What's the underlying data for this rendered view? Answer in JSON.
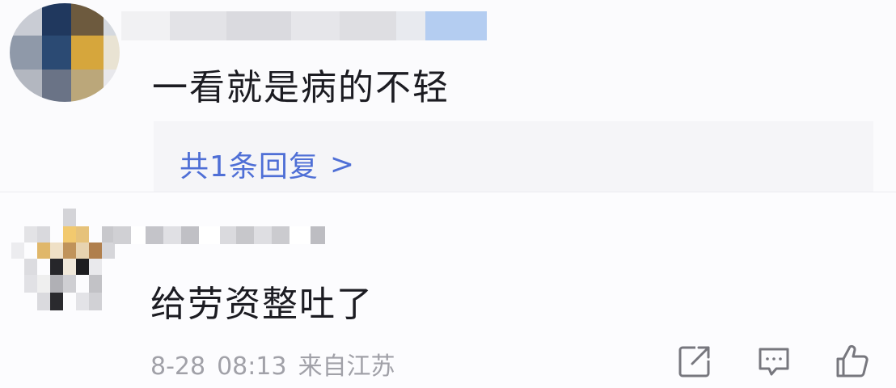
{
  "comments": [
    {
      "text": "一看就是病的不轻",
      "replies_link": "共1条回复",
      "replies_chevron": ">"
    },
    {
      "text": "给劳资整吐了",
      "date": "8-28",
      "time": "08:13",
      "location": "来自江苏"
    }
  ],
  "actions": {
    "share_icon": "share-icon",
    "reply_icon": "comment-icon",
    "like_icon": "thumbs-up-icon"
  },
  "colors": {
    "link": "#4f6fd6",
    "text": "#1c1c22",
    "meta": "#a1a1a8"
  }
}
